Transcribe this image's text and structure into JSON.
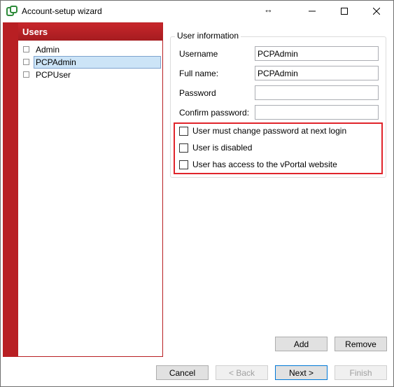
{
  "window": {
    "title": "Account-setup wizard",
    "resize_glyph": "↔"
  },
  "users_panel": {
    "header": "Users",
    "items": [
      {
        "name": "Admin",
        "selected": false
      },
      {
        "name": "PCPAdmin",
        "selected": true
      },
      {
        "name": "PCPUser",
        "selected": false
      }
    ]
  },
  "user_info": {
    "legend": "User information",
    "username_label": "Username",
    "username_value": "PCPAdmin",
    "fullname_label": "Full name:",
    "fullname_value": "PCPAdmin",
    "password_label": "Password",
    "password_value": "",
    "confirm_label": "Confirm password:",
    "confirm_value": "",
    "chk_must_change": {
      "label": "User must change password at next login",
      "checked": false
    },
    "chk_disabled": {
      "label": "User is disabled",
      "checked": false
    },
    "chk_vportal": {
      "label": "User has access to the vPortal website",
      "checked": false
    }
  },
  "buttons": {
    "add": "Add",
    "remove": "Remove",
    "cancel": "Cancel",
    "back": "< Back",
    "next": "Next >",
    "finish": "Finish"
  },
  "colors": {
    "accent_red": "#b81f23",
    "highlight_red": "#e0242b",
    "selection_blue": "#cce4f7"
  }
}
